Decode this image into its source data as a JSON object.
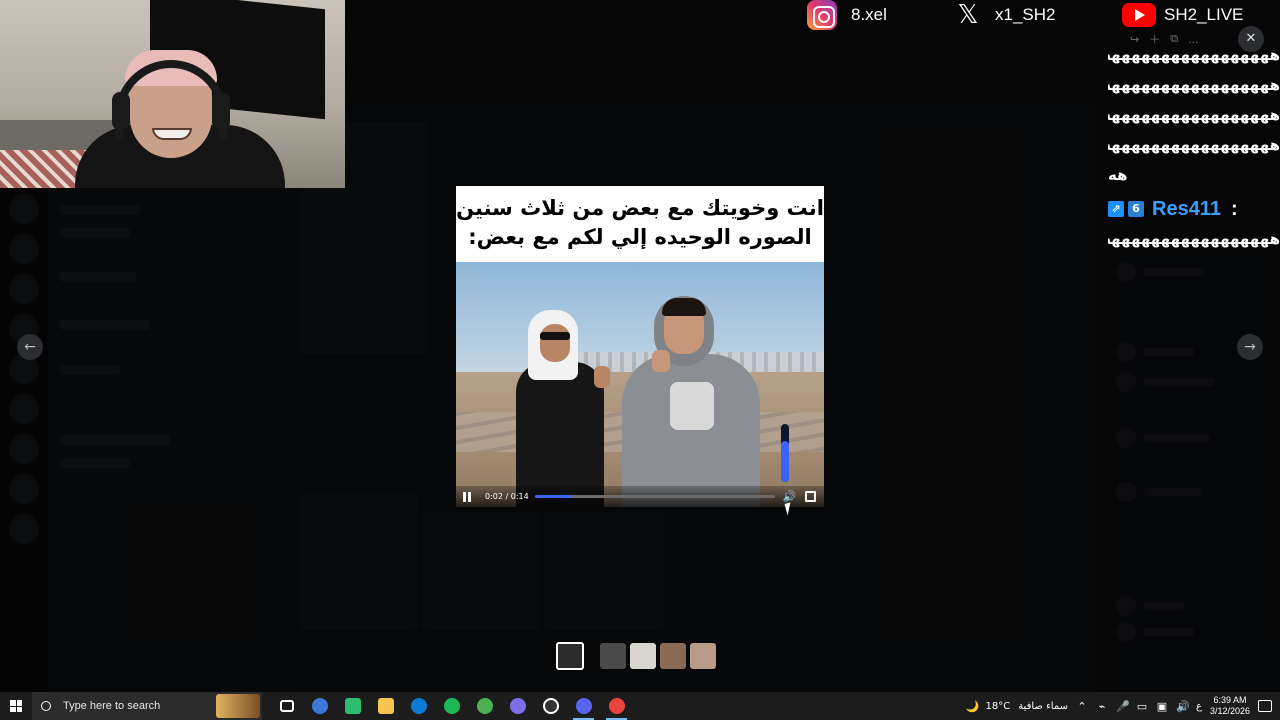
{
  "socials": {
    "instagram": "8.xel",
    "x": "x1_SH2",
    "youtube": "SH2_LIVE"
  },
  "viewer": {
    "prev_icon": "←",
    "next_icon": "→",
    "close_icon": "✕",
    "more_icon": "..."
  },
  "video": {
    "caption_line1": "انت وخويتك مع بعض من ثلاث سنين",
    "caption_line2": "الصوره الوحيده إلي لكم مع بعض:",
    "time": "0:02 / 0:14",
    "progress": 0.15,
    "volume": 0.7,
    "volume_icon": "🔊"
  },
  "chat": {
    "lines": [
      "هههههههههههههههههه",
      "هههههههههههههههههه",
      "هههههههههههههههههه",
      "هههههههههههههههههه",
      "هه"
    ],
    "user": {
      "badge1": "⇗",
      "badge2": "6",
      "name": "Res411",
      "colon": ":",
      "message": "هههههههههههههههههه"
    }
  },
  "taskbar": {
    "search_placeholder": "Type here to search",
    "weather_icon": "🌙",
    "temperature": "18°C",
    "weather_text": "سماء صافية",
    "lang": "ع",
    "time": "6:39 AM",
    "date": "3/12/2026",
    "app_colors": [
      "#3b78d8",
      "#2dbd6e",
      "#f5c451",
      "#0f7ad6",
      "#1db954",
      "#4caf50",
      "#7d6ee8",
      "#e34c4c",
      "#5865f2",
      "#e8453c"
    ]
  }
}
